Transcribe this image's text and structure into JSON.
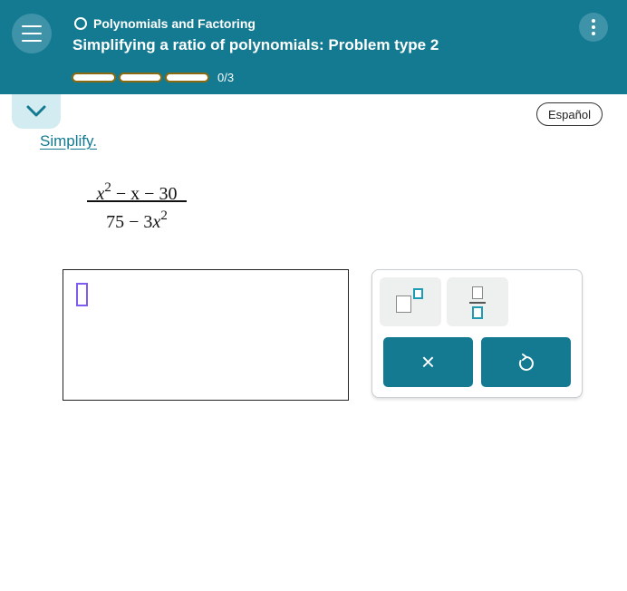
{
  "header": {
    "topic": "Polynomials and Factoring",
    "title": "Simplifying a ratio of polynomials: Problem type 2",
    "progress_text": "0/3",
    "progress": {
      "completed": 0,
      "total": 3
    }
  },
  "language_button": "Español",
  "instruction": "Simplify.",
  "expression": {
    "numerator": {
      "var": "x",
      "exp": "2",
      "rest": " − x − 30"
    },
    "denominator": {
      "const": "75 − 3",
      "var": "x",
      "exp": "2"
    }
  },
  "keypad": {
    "clear_symbol": "×"
  },
  "colors": {
    "header_bg": "#137a92",
    "accent": "#1f9bb4",
    "progress_track": "#8a6a10",
    "cursor": "#7e5cf0"
  },
  "icons": {
    "menu": "hamburger-menu-icon",
    "more": "vertical-dots-icon",
    "collapse": "chevron-down-icon",
    "exponent": "exponent-template-icon",
    "fraction": "fraction-template-icon",
    "clear": "close-icon",
    "undo": "undo-icon"
  }
}
